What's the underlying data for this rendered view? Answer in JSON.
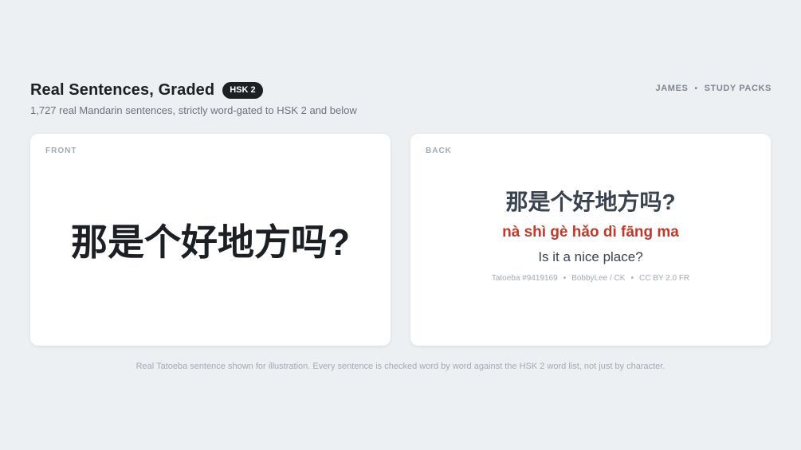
{
  "header": {
    "title": "Real Sentences, Graded",
    "badge": "HSK 2",
    "subtitle": "1,727 real Mandarin sentences, strictly word-gated to HSK 2 and below"
  },
  "nav": {
    "user": "JAMES",
    "separator": "•",
    "study_packs": "STUDY PACKS"
  },
  "front_card": {
    "label": "FRONT",
    "hanzi": "那是个好地方吗?"
  },
  "back_card": {
    "label": "BACK",
    "hanzi": "那是个好地方吗?",
    "pinyin": "nà shì gè hǎo dì fāng ma",
    "translation": "Is it a nice place?",
    "source_id": "Tatoeba #9419169",
    "authors": "BobbyLee / CK",
    "license": "CC BY 2.0 FR",
    "dot": "•"
  },
  "footnote": "Real Tatoeba sentence shown for illustration. Every sentence is checked word by word against the HSK 2 word list, not just by character.",
  "colors": {
    "background": "#edf0f3",
    "pinyin": "#c0392b",
    "badge": "#1c1f24"
  }
}
